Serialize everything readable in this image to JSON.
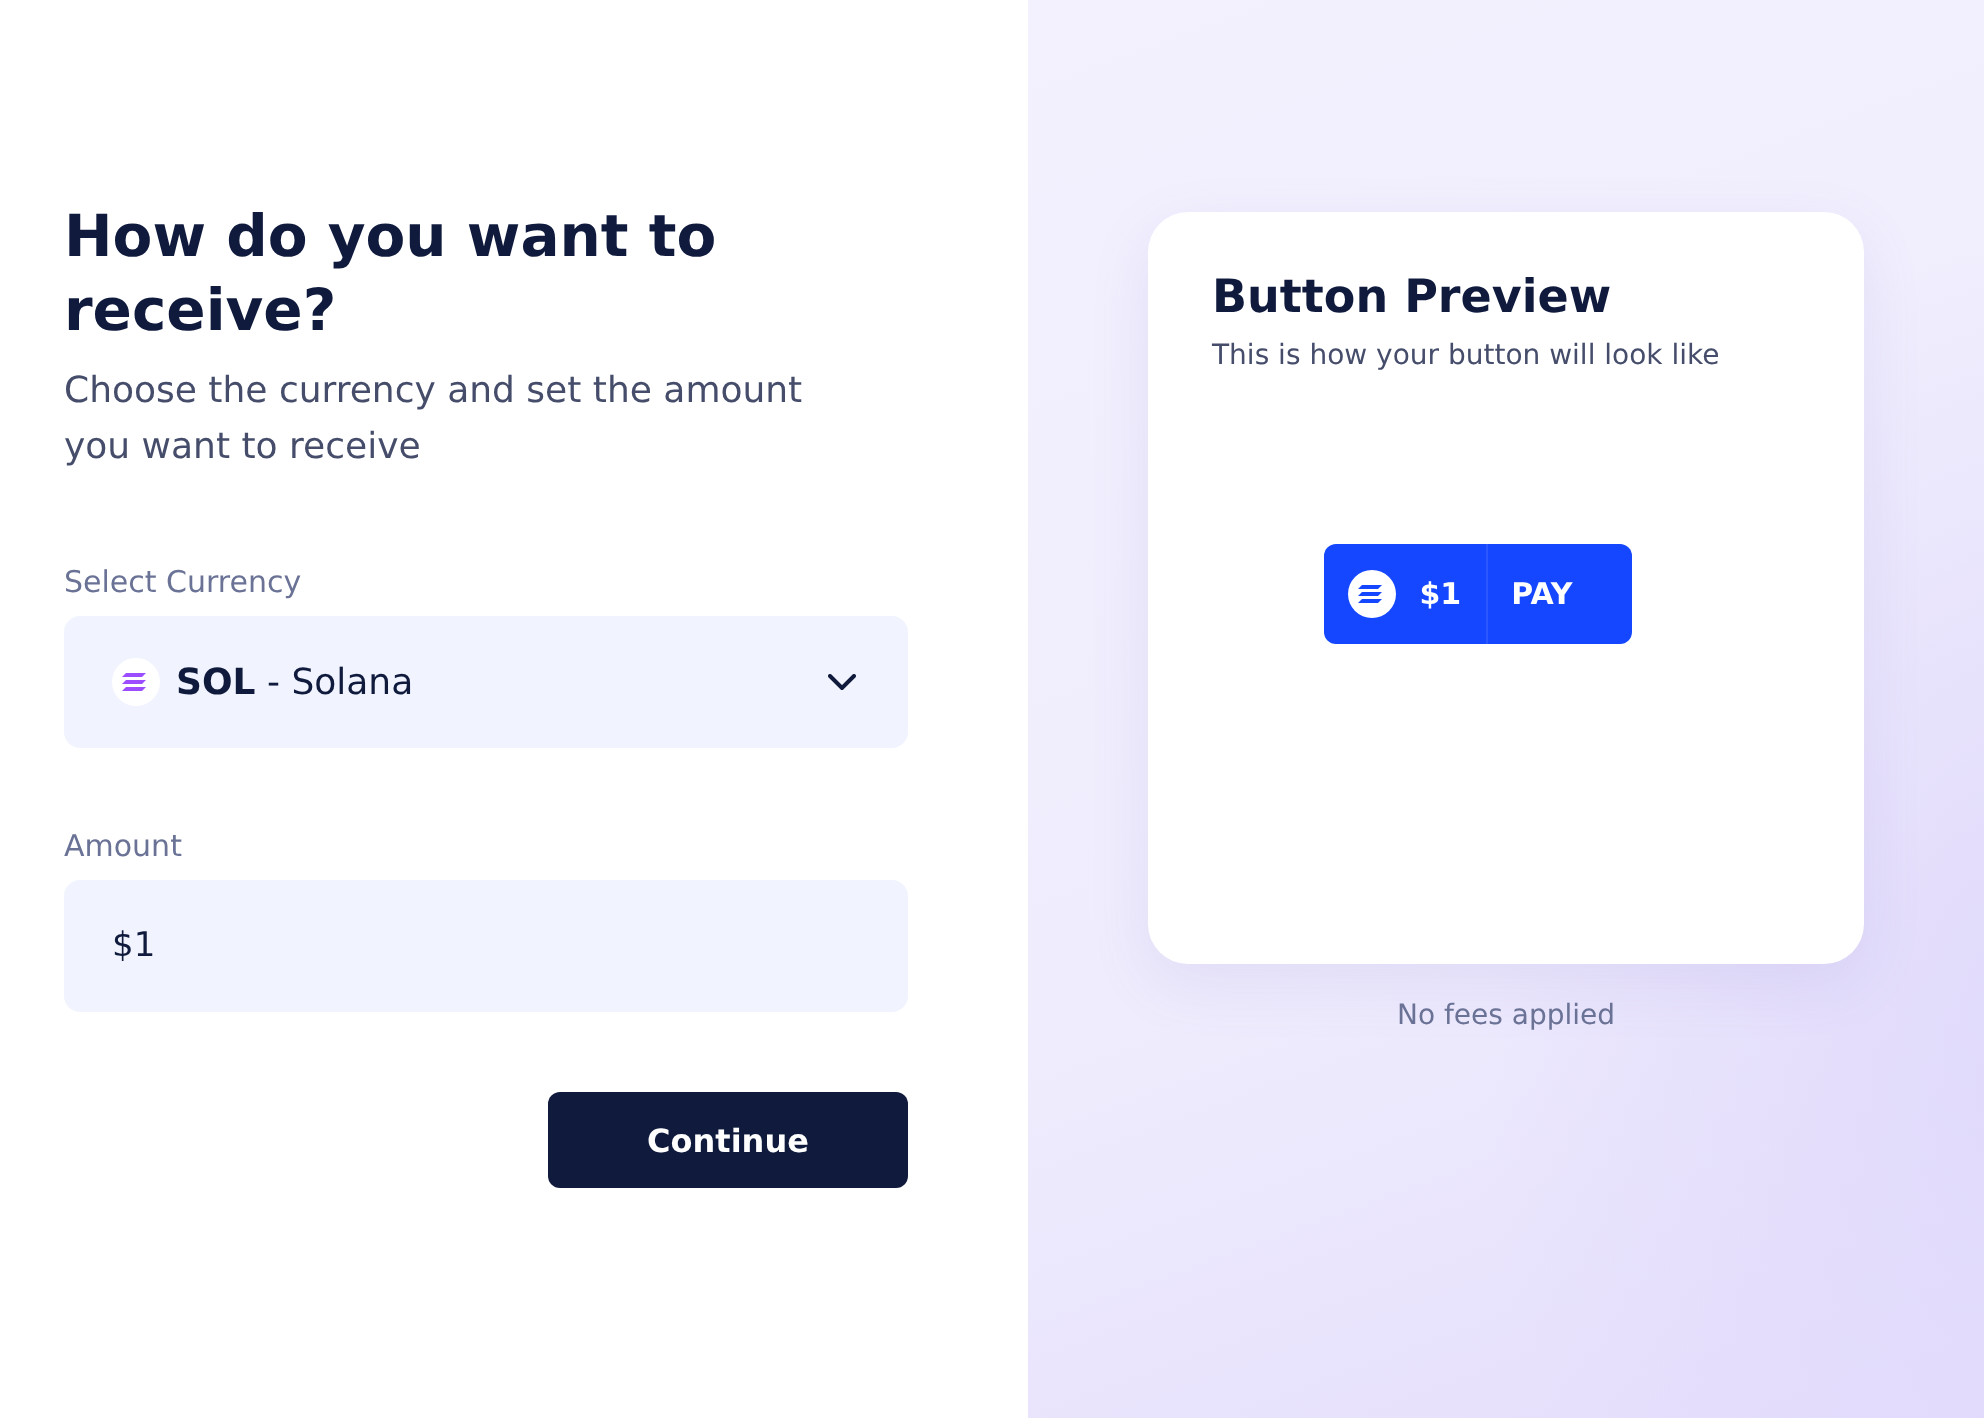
{
  "form": {
    "title": "How do you want to receive?",
    "subtitle": "Choose the currency and set the amount you want to receive",
    "currency": {
      "label": "Select Currency",
      "value": "**SOL** - Solana"
    },
    "amount": {
      "label": "Amount",
      "value": "$1"
    },
    "continue_button": "Continue"
  },
  "preview": {
    "title": "Button Preview",
    "subtitle": "This is how your button will look like",
    "pay_button": {
      "amount": "$1",
      "label": "PAY"
    },
    "note": "No fees applied"
  }
}
